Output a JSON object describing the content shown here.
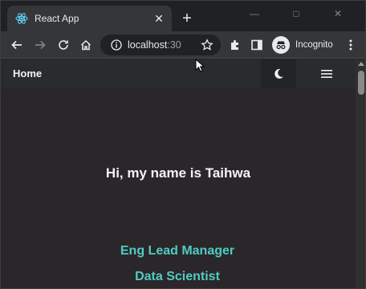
{
  "browser": {
    "tab_title": "React App",
    "tab_close_icon": "close-icon",
    "new_tab_label": "+",
    "url_host": "localhost",
    "url_rest": ":30",
    "profile_label": "Incognito",
    "window_controls": {
      "minimize": "—",
      "maximize": "□",
      "close": "✕"
    }
  },
  "page": {
    "nav": {
      "home_label": "Home",
      "theme_icon": "moon-icon",
      "menu_icon": "hamburger-icon"
    },
    "greeting": "Hi, my name is Taihwa",
    "roles": [
      "Eng Lead Manager",
      "Data Scientist"
    ],
    "colors": {
      "background": "#2b262a",
      "accent": "#4ecdc4",
      "text": "#f4f4f4"
    }
  }
}
